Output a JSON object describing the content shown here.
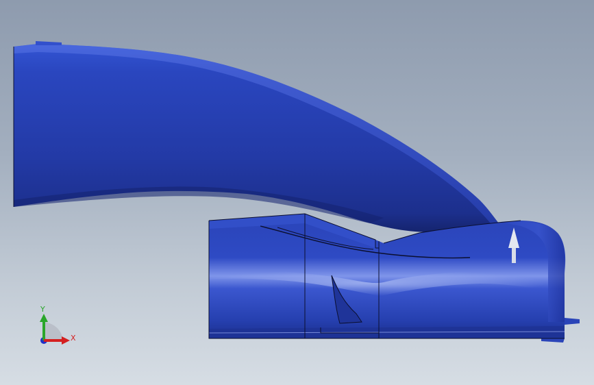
{
  "viewport": {
    "background_top": "#8e9bae",
    "background_bottom": "#d6dde4",
    "model_color": "#2a44b8",
    "model_highlight": "#6f86e0",
    "model_shadow": "#16267a",
    "edge_color": "#0b0f2e"
  },
  "triad": {
    "y_label": "Y",
    "x_label": "X",
    "y_color": "#2aa62a",
    "x_color": "#d42020",
    "z_color": "#2030c8"
  },
  "annotations": {
    "direction_arrow_icon": "up-arrow-icon"
  }
}
